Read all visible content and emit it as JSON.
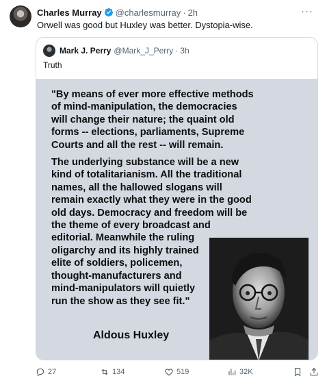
{
  "tweet": {
    "author_name": "Charles Murray",
    "author_handle": "@charlesmurray",
    "separator": "·",
    "time": "2h",
    "more": "···",
    "text": "Orwell was good but Huxley was better. Dystopia-wise."
  },
  "quoted": {
    "author_name": "Mark J. Perry",
    "author_handle": "@Mark_J_Perry",
    "separator": "·",
    "time": "3h",
    "text": "Truth",
    "image": {
      "paragraph1": "\"By means of ever more effective methods\nof mind-manipulation, the democracies\nwill change their nature; the quaint old\nforms -- elections, parliaments, Supreme\nCourts and all the rest -- will remain.",
      "paragraph2": "The underlying substance will be a new\nkind of  totalitarianism. All the traditional\nnames, all the hallowed slogans will\nremain exactly what they were in the good\n old days. Democracy and freedom will be\nthe theme of every broadcast and\neditorial. Meanwhile the ruling\noligarchy and its highly trained\nelite of soldiers, policemen,\nthought-manufacturers and\nmind-manipulators will quietly\nrun the show as they see fit.\"",
      "author": "Aldous Huxley",
      "background_color": "#d3d8e1"
    }
  },
  "actions": {
    "replies": "27",
    "retweets": "134",
    "likes": "519",
    "views": "32K"
  },
  "colors": {
    "text": "#0f1419",
    "secondary": "#536471",
    "verified": "#1d9bf0",
    "border": "#cfd9de"
  }
}
